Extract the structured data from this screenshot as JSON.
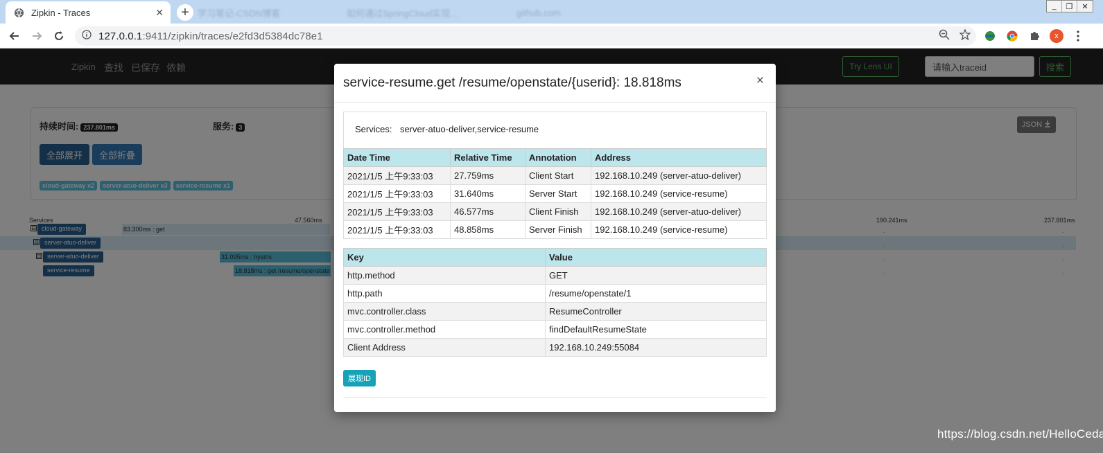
{
  "browser": {
    "active_tab": {
      "title": "Zipkin - Traces",
      "close": "✕"
    },
    "inactive_tabs": [
      {
        "title": "学习笔记-CSDN博客"
      },
      {
        "title": "如何通过SpringCloud实现…"
      },
      {
        "title": "github.com"
      }
    ],
    "new_tab_symbol": "+",
    "url_host": "127.0.0.1",
    "url_rest": ":9411/zipkin/traces/e2fd3d5384dc78e1",
    "profile_initial": "x",
    "window_controls": [
      "_",
      "❐",
      "✕"
    ]
  },
  "zipkin": {
    "nav": {
      "brand": "Zipkin",
      "links": [
        "查找",
        "已保存",
        "依赖"
      ],
      "try_lens": "Try Lens UI",
      "traceid_placeholder": "请输入traceid",
      "search_button": "搜索"
    },
    "summary": {
      "duration_label": "持续时间:",
      "duration_value": "237.801ms",
      "services_label": "服务:",
      "services_count": "3",
      "expand_all": "全部展开",
      "collapse_all": "全部折叠",
      "json_button": "JSON",
      "service_tags": [
        "cloud-gateway x2",
        "server-atuo-deliver x3",
        "service-resume x1"
      ]
    },
    "timeline": {
      "header_services": "Services",
      "ticks": [
        "47.560ms",
        "190.241ms",
        "237.801ms"
      ],
      "rows": [
        {
          "service": "cloud-gateway",
          "span": "83.300ms : get",
          "toggle": "⊟"
        },
        {
          "service": "server-atuo-deliver",
          "span": "",
          "toggle": "⊟"
        },
        {
          "service": "server-atuo-deliver",
          "span": "31.095ms : hystrix",
          "toggle": "⊟"
        },
        {
          "service": "service-resume",
          "span": "18.818ms : get /resume/openstate",
          "toggle": ""
        }
      ]
    }
  },
  "modal": {
    "title": "service-resume.get /resume/openstate/{userid}: 18.818ms",
    "close": "×",
    "services_label": "Services:",
    "services_value": "server-atuo-deliver,service-resume",
    "annotations": {
      "headers": [
        "Date Time",
        "Relative Time",
        "Annotation",
        "Address"
      ],
      "rows": [
        [
          "2021/1/5 上午9:33:03",
          "27.759ms",
          "Client Start",
          "192.168.10.249 (server-atuo-deliver)"
        ],
        [
          "2021/1/5 上午9:33:03",
          "31.640ms",
          "Server Start",
          "192.168.10.249 (service-resume)"
        ],
        [
          "2021/1/5 上午9:33:03",
          "46.577ms",
          "Client Finish",
          "192.168.10.249 (server-atuo-deliver)"
        ],
        [
          "2021/1/5 上午9:33:03",
          "48.858ms",
          "Server Finish",
          "192.168.10.249 (service-resume)"
        ]
      ]
    },
    "tags": {
      "headers": [
        "Key",
        "Value"
      ],
      "rows": [
        [
          "http.method",
          "GET"
        ],
        [
          "http.path",
          "/resume/openstate/1"
        ],
        [
          "mvc.controller.class",
          "ResumeController"
        ],
        [
          "mvc.controller.method",
          "findDefaultResumeState"
        ],
        [
          "Client Address",
          "192.168.10.249:55084"
        ]
      ]
    },
    "show_id_button": "展现ID"
  },
  "watermark": "https://blog.csdn.net/HelloCedar"
}
